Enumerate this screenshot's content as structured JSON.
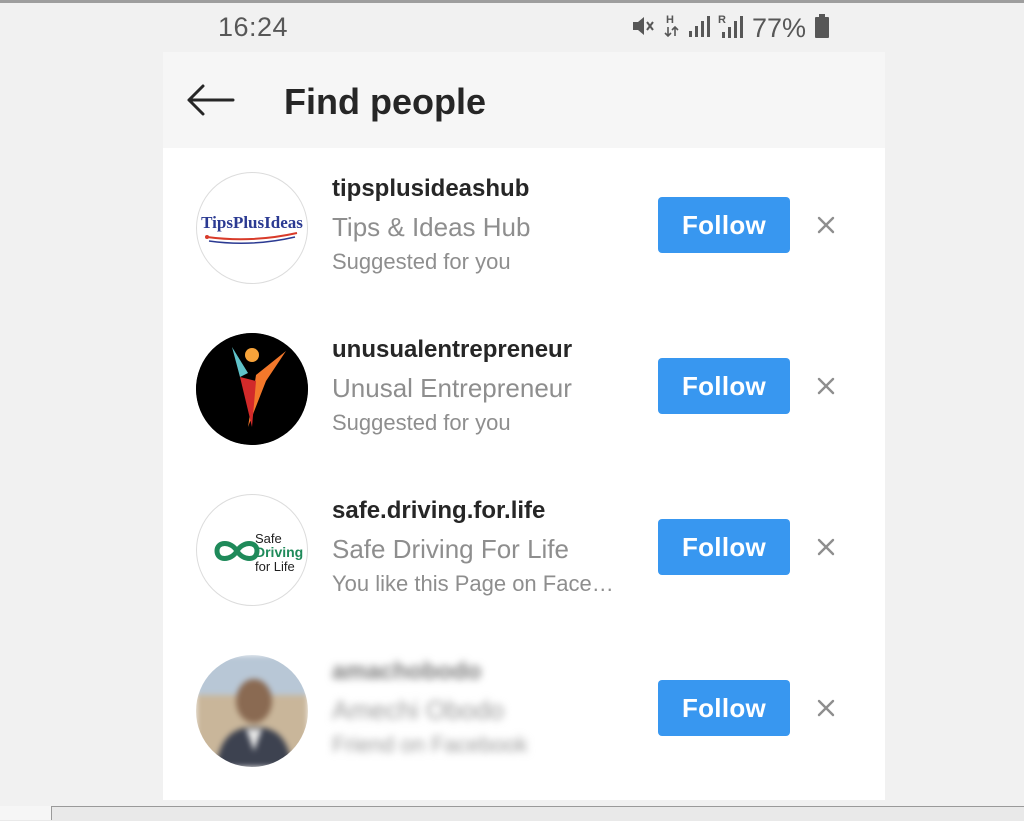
{
  "status_bar": {
    "time": "16:24",
    "icons": [
      "mute-icon",
      "hspa-icon",
      "signal-icon",
      "roaming-signal-icon"
    ],
    "battery_percent": "77%"
  },
  "header": {
    "back_icon": "arrow-left-icon",
    "title": "Find people"
  },
  "suggestions": [
    {
      "username": "tipsplusideashub",
      "full_name": "Tips & Ideas Hub",
      "reason": "Suggested for you",
      "avatar_text": "TipsPlusIdeas",
      "follow_label": "Follow",
      "dismiss_icon": "close-icon"
    },
    {
      "username": "unusualentrepreneur",
      "full_name": "Unusal Entrepreneur",
      "reason": "Suggested for you",
      "follow_label": "Follow",
      "dismiss_icon": "close-icon"
    },
    {
      "username": "safe.driving.for.life",
      "full_name": "Safe Driving For Life",
      "reason": "You like this Page on Face…",
      "avatar_text": [
        "Safe",
        "Driving",
        "for Life"
      ],
      "follow_label": "Follow",
      "dismiss_icon": "close-icon"
    },
    {
      "username": "amachobodo",
      "full_name": "Amechi Obodo",
      "reason": "Friend on Facebook",
      "follow_label": "Follow",
      "dismiss_icon": "close-icon"
    }
  ],
  "colors": {
    "follow_button": "#3897f0",
    "header_bg": "#f6f6f6",
    "secondary_text": "#8e8e8e"
  }
}
